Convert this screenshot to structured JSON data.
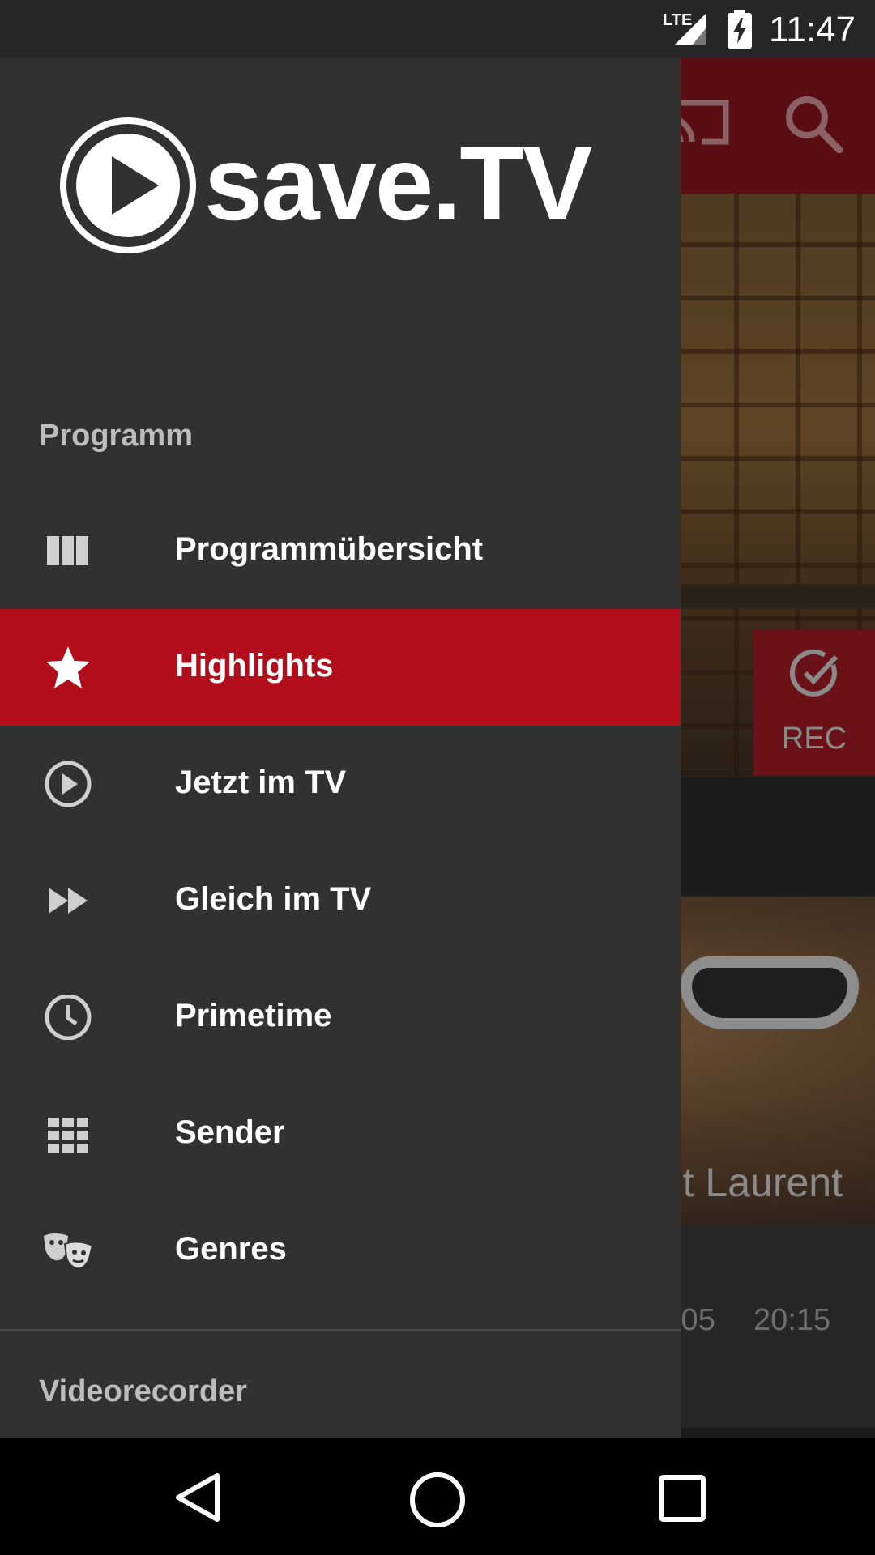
{
  "status_bar": {
    "network": "LTE",
    "time": "11:47"
  },
  "background": {
    "rec_label": "REC",
    "title_fragment": "t Laurent",
    "date_fragment": ".05",
    "time_fragment": "20:15"
  },
  "drawer": {
    "brand_word": "save.TV",
    "section_programm": "Programm",
    "items": [
      {
        "label": "Programmübersicht",
        "icon": "view-columns-icon",
        "active": false
      },
      {
        "label": "Highlights",
        "icon": "star-icon",
        "active": true
      },
      {
        "label": "Jetzt im TV",
        "icon": "play-circle-icon",
        "active": false
      },
      {
        "label": "Gleich im TV",
        "icon": "fast-forward-icon",
        "active": false
      },
      {
        "label": "Primetime",
        "icon": "clock-icon",
        "active": false
      },
      {
        "label": "Sender",
        "icon": "grid-icon",
        "active": false
      },
      {
        "label": "Genres",
        "icon": "theater-masks-icon",
        "active": false
      }
    ],
    "section_videorecorder": "Videorecorder"
  },
  "colors": {
    "accent": "#b20d1b",
    "drawer_bg": "#313131",
    "statusbar_bg": "#262626"
  }
}
